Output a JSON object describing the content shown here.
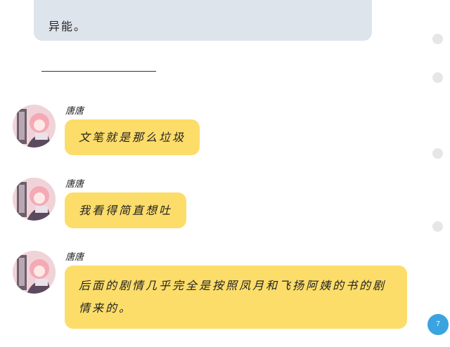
{
  "top_message": {
    "text": "异能。"
  },
  "messages": [
    {
      "sender": "唐唐",
      "text": "文笔就是那么垃圾"
    },
    {
      "sender": "唐唐",
      "text": "我看得简直想吐"
    },
    {
      "sender": "唐唐",
      "text": "后面的剧情几乎完全是按照凤月和飞扬阿姨的书的剧情来的。"
    }
  ],
  "page_indicator": "7",
  "colors": {
    "bubble_yellow": "#fcdd6a",
    "bubble_gray": "#dee4ec",
    "badge_blue": "#3ba3e0"
  }
}
